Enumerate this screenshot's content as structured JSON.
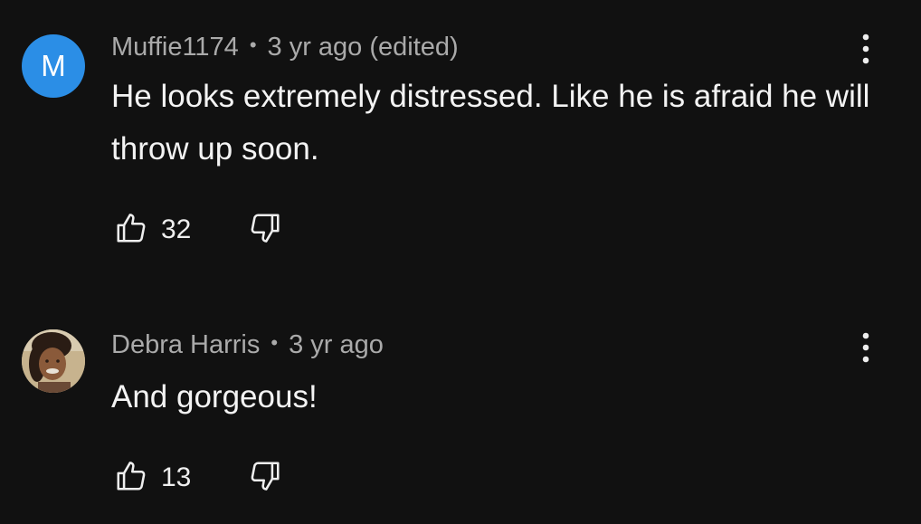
{
  "comments": [
    {
      "avatar_letter": "M",
      "avatar_color": "#2b8ee6",
      "author": "Muffie1174",
      "separator": "•",
      "time": "3 yr ago (edited)",
      "text": "He looks extremely distressed. Like he is afraid he will throw up soon.",
      "likes": "32",
      "icons": {
        "like": "thumbs-up-icon",
        "dislike": "thumbs-down-icon",
        "menu": "more-vert-icon"
      }
    },
    {
      "avatar_type": "photo",
      "author": "Debra Harris",
      "separator": "•",
      "time": "3 yr ago",
      "text": "And gorgeous!",
      "likes": "13",
      "icons": {
        "like": "thumbs-up-icon",
        "dislike": "thumbs-down-icon",
        "menu": "more-vert-icon"
      }
    }
  ],
  "theme": {
    "background": "#111111",
    "text_primary": "#f3f3f3",
    "text_secondary": "#aaaaaa"
  }
}
